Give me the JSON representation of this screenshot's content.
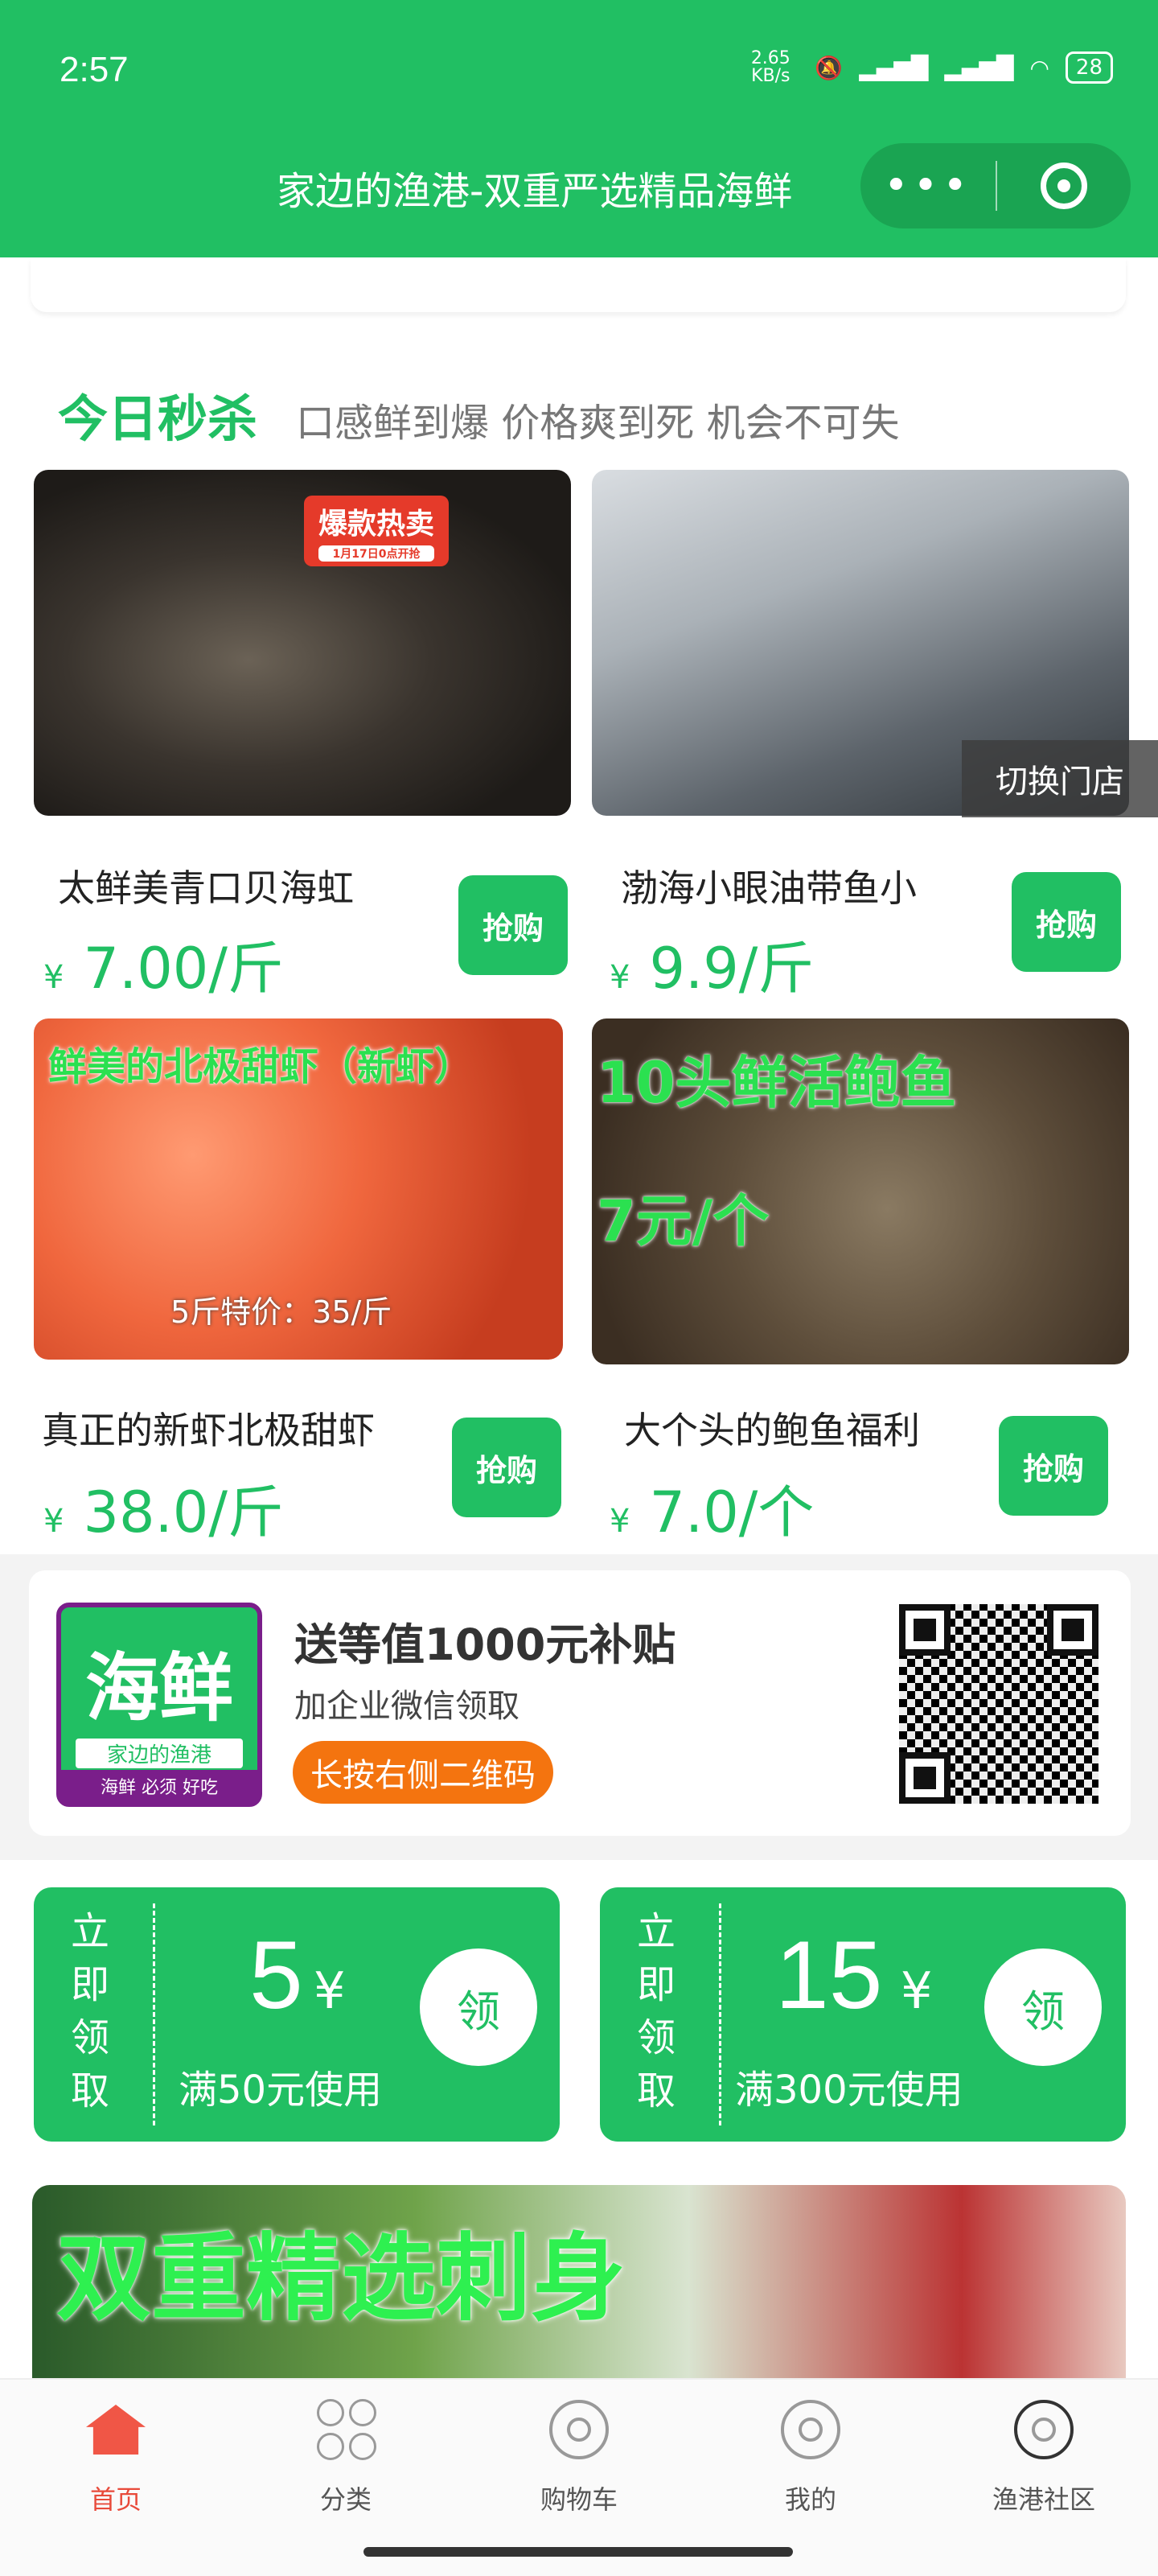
{
  "status_bar": {
    "time": "2:57",
    "net_speed": "2.65 KB/s",
    "battery": "28"
  },
  "header": {
    "title": "家边的渔港-双重严选精品海鲜",
    "more": "•••"
  },
  "flash_sale": {
    "title": "今日秒杀",
    "subtitle": "口感鲜到爆 价格爽到死 机会不可失"
  },
  "products": [
    {
      "name": "太鲜美青口贝海虹",
      "yen": "¥",
      "price": "7.00/斤",
      "buy": "抢购",
      "badge": "爆款热卖",
      "badge_sub": "1月17日0点开抢"
    },
    {
      "name": "渤海小眼油带鱼小",
      "yen": "¥",
      "price": "9.9/斤",
      "buy": "抢购"
    },
    {
      "name": "真正的新虾北极甜虾",
      "yen": "¥",
      "price": "38.0/斤",
      "buy": "抢购",
      "overlay_top": "鲜美的北极甜虾（新虾）",
      "overlay_bottom": "5斤特价：35/斤"
    },
    {
      "name": "大个头的鲍鱼福利",
      "yen": "¥",
      "price": "7.0/个",
      "buy": "抢购",
      "overlay_top": "10头鲜活鲍鱼",
      "overlay_mid": "7元/个"
    }
  ],
  "switch_store": "切换门店",
  "promo": {
    "logo_big": "海鲜",
    "logo_sub": "家边的渔港",
    "logo_foot": "海鲜 必须 好吃",
    "title": "送等值1000元补贴",
    "line": "加企业微信领取",
    "pill": "长按右侧二维码"
  },
  "coupons": [
    {
      "side": "立即领取",
      "amount": "5",
      "currency": "¥",
      "condition": "满50元使用",
      "get": "领"
    },
    {
      "side": "立即领取",
      "amount": "15",
      "currency": "¥",
      "condition": "满300元使用",
      "get": "领"
    }
  ],
  "banner": {
    "text": "双重精选刺身"
  },
  "tabbar": [
    {
      "label": "首页",
      "icon": "home-icon"
    },
    {
      "label": "分类",
      "icon": "category-icon"
    },
    {
      "label": "购物车",
      "icon": "cart-icon"
    },
    {
      "label": "我的",
      "icon": "profile-icon"
    },
    {
      "label": "渔港社区",
      "icon": "community-icon"
    }
  ],
  "colors": {
    "brand_green": "#21bf63",
    "tab_active": "#e84a3a",
    "promo_orange": "#f4740f"
  }
}
